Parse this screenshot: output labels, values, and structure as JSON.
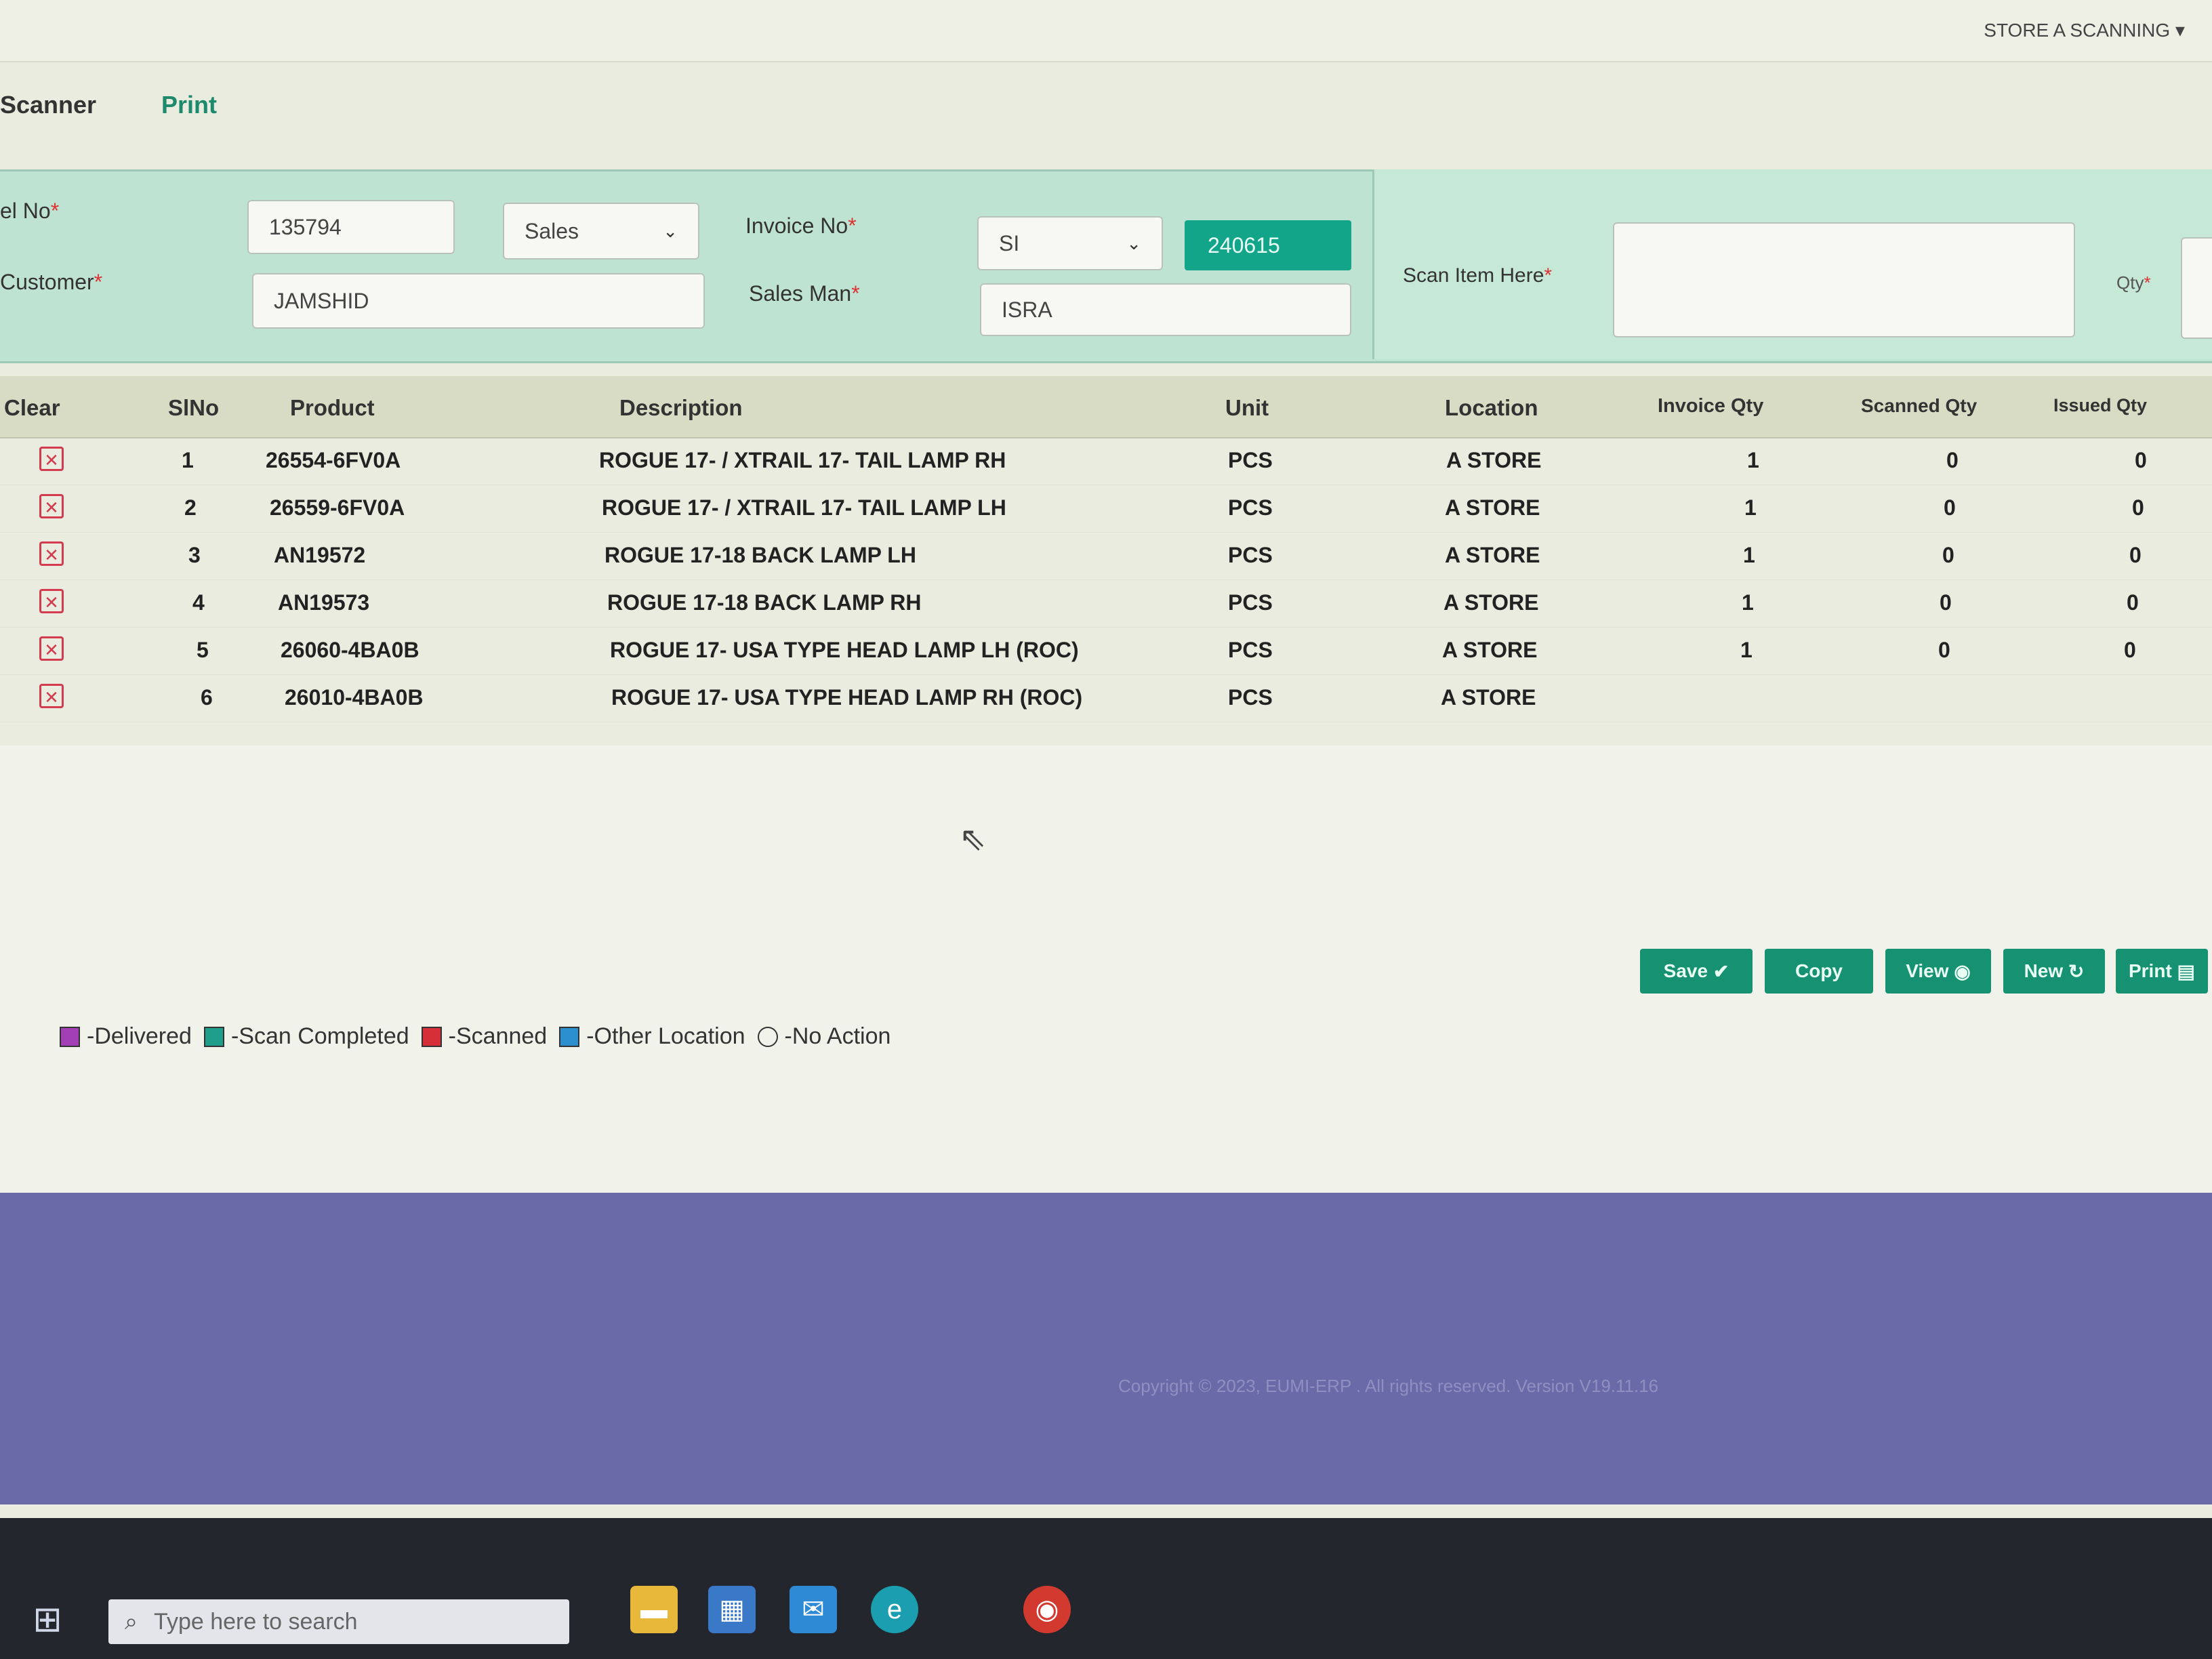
{
  "header": {
    "store_menu": "STORE A SCANNING"
  },
  "tabs": {
    "scanner": "Scanner",
    "print": "Print"
  },
  "form": {
    "sel_no_label": "el No",
    "sel_no_value": "135794",
    "type_value": "Sales",
    "customer_label": "Customer",
    "customer_value": "JAMSHID",
    "invoice_no_label": "Invoice No",
    "invoice_prefix": "SI",
    "invoice_number": "240615",
    "sales_man_label": "Sales Man",
    "sales_man_value": "ISRA",
    "scan_item_label": "Scan Item Here",
    "scan_item_value": "",
    "qty_label": "Qty",
    "required_mark": "*"
  },
  "table": {
    "headers": {
      "clear": "Clear",
      "slno": "SlNo",
      "product": "Product",
      "description": "Description",
      "unit": "Unit",
      "location": "Location",
      "invoice_qty": "Invoice Qty",
      "scanned_qty": "Scanned Qty",
      "issued_qty": "Issued Qty"
    },
    "rows": [
      {
        "slno": "1",
        "product": "26554-6FV0A",
        "description": "ROGUE 17- / XTRAIL 17- TAIL LAMP RH",
        "unit": "PCS",
        "location": "A STORE",
        "invoice_qty": "1",
        "scanned_qty": "0",
        "issued_qty": "0"
      },
      {
        "slno": "2",
        "product": "26559-6FV0A",
        "description": "ROGUE 17- / XTRAIL 17- TAIL LAMP LH",
        "unit": "PCS",
        "location": "A STORE",
        "invoice_qty": "1",
        "scanned_qty": "0",
        "issued_qty": "0"
      },
      {
        "slno": "3",
        "product": "AN19572",
        "description": "ROGUE 17-18 BACK LAMP LH",
        "unit": "PCS",
        "location": "A STORE",
        "invoice_qty": "1",
        "scanned_qty": "0",
        "issued_qty": "0"
      },
      {
        "slno": "4",
        "product": "AN19573",
        "description": "ROGUE 17-18 BACK LAMP RH",
        "unit": "PCS",
        "location": "A STORE",
        "invoice_qty": "1",
        "scanned_qty": "0",
        "issued_qty": "0"
      },
      {
        "slno": "5",
        "product": "26060-4BA0B",
        "description": "ROGUE 17- USA TYPE HEAD LAMP LH (ROC)",
        "unit": "PCS",
        "location": "A STORE",
        "invoice_qty": "1",
        "scanned_qty": "0",
        "issued_qty": "0"
      },
      {
        "slno": "6",
        "product": "26010-4BA0B",
        "description": "ROGUE 17- USA TYPE HEAD LAMP RH (ROC)",
        "unit": "PCS",
        "location": "A STORE",
        "invoice_qty": "",
        "scanned_qty": "",
        "issued_qty": ""
      }
    ]
  },
  "actions": {
    "save": "Save",
    "copy": "Copy",
    "view": "View",
    "new": "New",
    "print": "Print"
  },
  "legend": {
    "delivered": "-Delivered",
    "scan_completed": "-Scan Completed",
    "scanned": "-Scanned",
    "other_location": "-Other Location",
    "no_action": "-No Action",
    "colors": {
      "delivered": "#a23fb4",
      "scan_completed": "#1f9e8c",
      "scanned": "#d62f3a",
      "other_location": "#2b8fd0"
    }
  },
  "footer": {
    "copyright": "Copyright © 2023, EUMI-ERP . All rights reserved. Version V19.11.16"
  },
  "taskbar": {
    "search_placeholder": "Type here to search",
    "icons": [
      "start-icon",
      "file-explorer-icon",
      "store-icon",
      "mail-icon",
      "edge-icon",
      "chrome-icon"
    ]
  }
}
